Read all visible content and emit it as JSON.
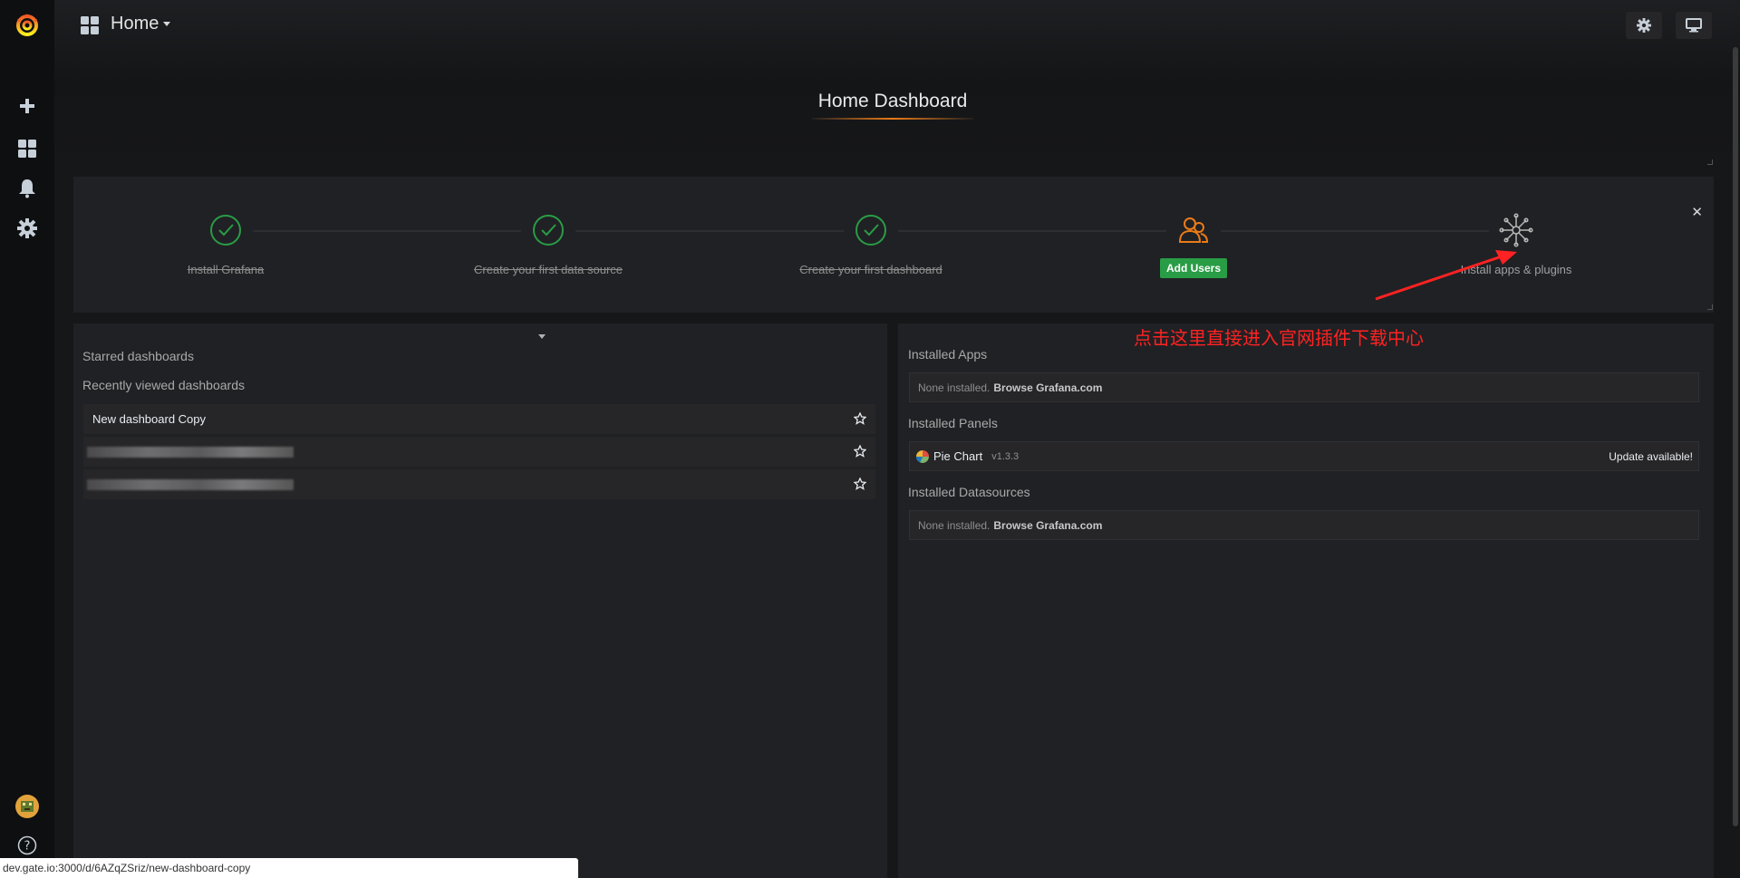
{
  "topnav": {
    "title": "Home"
  },
  "dashboard": {
    "title": "Home Dashboard"
  },
  "steps": [
    {
      "label": "Install Grafana",
      "done": true
    },
    {
      "label": "Create your first data source",
      "done": true
    },
    {
      "label": "Create your first dashboard",
      "done": true
    },
    {
      "label": "Add Users",
      "done": false
    },
    {
      "label": "Install apps & plugins",
      "done": false
    }
  ],
  "left": {
    "starred_title": "Starred dashboards",
    "recent_title": "Recently viewed dashboards",
    "recent": [
      {
        "name": "New dashboard Copy"
      }
    ]
  },
  "right": {
    "apps_title": "Installed Apps",
    "apps_empty": "None installed.",
    "apps_browse": "Browse Grafana.com",
    "panels_title": "Installed Panels",
    "panel_name": "Pie Chart",
    "panel_version": "v1.3.3",
    "panel_update": "Update available!",
    "ds_title": "Installed Datasources",
    "ds_empty": "None installed.",
    "ds_browse": "Browse Grafana.com"
  },
  "annotation": "点击这里直接进入官网插件下载中心",
  "statusbar": "dev.gate.io:3000/d/6AZqZSriz/new-dashboard-copy",
  "colors": {
    "accent": "#eb7b18",
    "success": "#299c46",
    "annotation": "#ff2222",
    "background": "#161719"
  }
}
